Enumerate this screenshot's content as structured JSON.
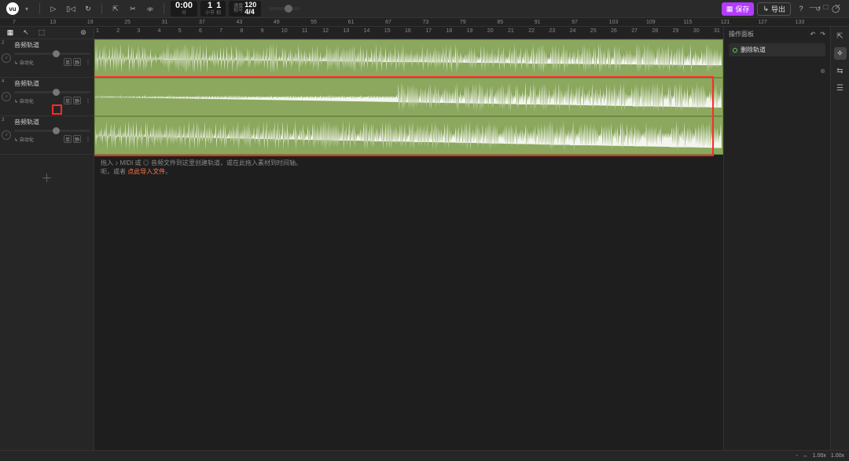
{
  "app": {
    "logo": "vu"
  },
  "transport": {
    "time": "0:00",
    "time_label": "分",
    "bar": "1",
    "beat": "1",
    "tempo_label": "速度",
    "tempo": "120",
    "tsig_label": "拍号",
    "tsig": "4/4"
  },
  "top_buttons": {
    "save": "保存",
    "export": "导出"
  },
  "minimap_markers": [
    7,
    13,
    19,
    25,
    31,
    37,
    43,
    49,
    55,
    61,
    67,
    73,
    79,
    85,
    91,
    97,
    103,
    109,
    115,
    121,
    127,
    133
  ],
  "ruler_ticks": [
    1,
    2,
    3,
    4,
    5,
    6,
    7,
    8,
    9,
    10,
    11,
    12,
    13,
    14,
    15,
    16,
    17,
    18,
    19,
    20,
    21,
    22,
    23,
    24,
    25,
    26,
    27,
    28,
    29,
    30,
    31
  ],
  "tracks": [
    {
      "num": "2",
      "name": "音频轨道",
      "auto": "↳ 自动化",
      "mute": "单",
      "solo": "静"
    },
    {
      "num": "4",
      "name": "音频轨道",
      "auto": "↳ 自动化",
      "mute": "单",
      "solo": "静"
    },
    {
      "num": "3",
      "name": "音频轨道",
      "auto": "↳ 自动化",
      "mute": "单",
      "solo": "静"
    }
  ],
  "hint": {
    "prefix": "拖入 ♪ MIDI 或 ",
    "circle": "◎",
    "mid": " 音频文件到这里创建轨道，或在此拖入素材到时间轴。",
    "line2_pre": "呃，或者",
    "link": "点此导入文件",
    "line2_post": "。"
  },
  "panel": {
    "title": "操作面板",
    "item": "删除轨道"
  },
  "bottom": {
    "zoom_h": "1.00x",
    "zoom_v": "1.00x"
  }
}
